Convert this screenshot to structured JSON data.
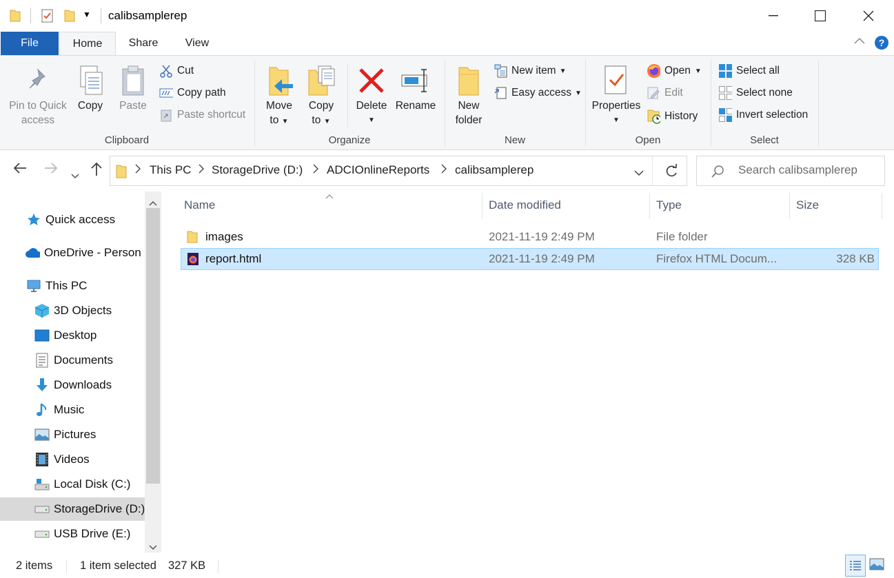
{
  "window": {
    "title": "calibsamplerep",
    "minimize": "—",
    "maximize": "☐",
    "close": "✕"
  },
  "tabs": {
    "file": "File",
    "home": "Home",
    "share": "Share",
    "view": "View"
  },
  "ribbon": {
    "clipboard": {
      "label": "Clipboard",
      "pin_line1": "Pin to Quick",
      "pin_line2": "access",
      "copy": "Copy",
      "paste": "Paste",
      "cut": "Cut",
      "copy_path": "Copy path",
      "paste_shortcut": "Paste shortcut"
    },
    "organize": {
      "label": "Organize",
      "move_line1": "Move",
      "move_line2": "to",
      "copy_line1": "Copy",
      "copy_line2": "to",
      "delete": "Delete",
      "rename": "Rename"
    },
    "new": {
      "label": "New",
      "new_folder_line1": "New",
      "new_folder_line2": "folder",
      "new_item": "New item",
      "easy_access": "Easy access"
    },
    "open": {
      "label": "Open",
      "properties": "Properties",
      "open": "Open",
      "edit": "Edit",
      "history": "History"
    },
    "select": {
      "label": "Select",
      "select_all": "Select all",
      "select_none": "Select none",
      "invert_selection": "Invert selection"
    }
  },
  "address": {
    "crumbs": [
      "This PC",
      "StorageDrive (D:)",
      "ADCIOnlineReports",
      "calibsamplerep"
    ],
    "search_placeholder": "Search calibsamplerep"
  },
  "nav": {
    "items": [
      {
        "label": "Quick access",
        "icon": "star-icon"
      },
      {
        "label": "OneDrive - Person",
        "icon": "cloud-icon"
      },
      {
        "label": "This PC",
        "icon": "computer-icon"
      },
      {
        "label": "3D Objects",
        "icon": "cube-icon"
      },
      {
        "label": "Desktop",
        "icon": "desktop-icon"
      },
      {
        "label": "Documents",
        "icon": "documents-icon"
      },
      {
        "label": "Downloads",
        "icon": "download-icon"
      },
      {
        "label": "Music",
        "icon": "music-icon"
      },
      {
        "label": "Pictures",
        "icon": "pictures-icon"
      },
      {
        "label": "Videos",
        "icon": "videos-icon"
      },
      {
        "label": "Local Disk (C:)",
        "icon": "drive-icon"
      },
      {
        "label": "StorageDrive (D:)",
        "icon": "drive-icon"
      },
      {
        "label": "USB Drive (E:)",
        "icon": "usb-drive-icon"
      }
    ]
  },
  "columns": {
    "name": "Name",
    "date": "Date modified",
    "type": "Type",
    "size": "Size"
  },
  "files": [
    {
      "name": "images",
      "date": "2021-11-19 2:49 PM",
      "type": "File folder",
      "size": "",
      "icon": "folder-icon"
    },
    {
      "name": "report.html",
      "date": "2021-11-19 2:49 PM",
      "type": "Firefox HTML Docum...",
      "size": "328 KB",
      "icon": "firefox-html-icon"
    }
  ],
  "status": {
    "count": "2 items",
    "selected": "1 item selected",
    "selected_size": "327 KB"
  },
  "colors": {
    "file_tab": "#1e63b6",
    "selection": "#cce8ff",
    "selection_border": "#99d1ff",
    "folder": "#f8d775"
  }
}
